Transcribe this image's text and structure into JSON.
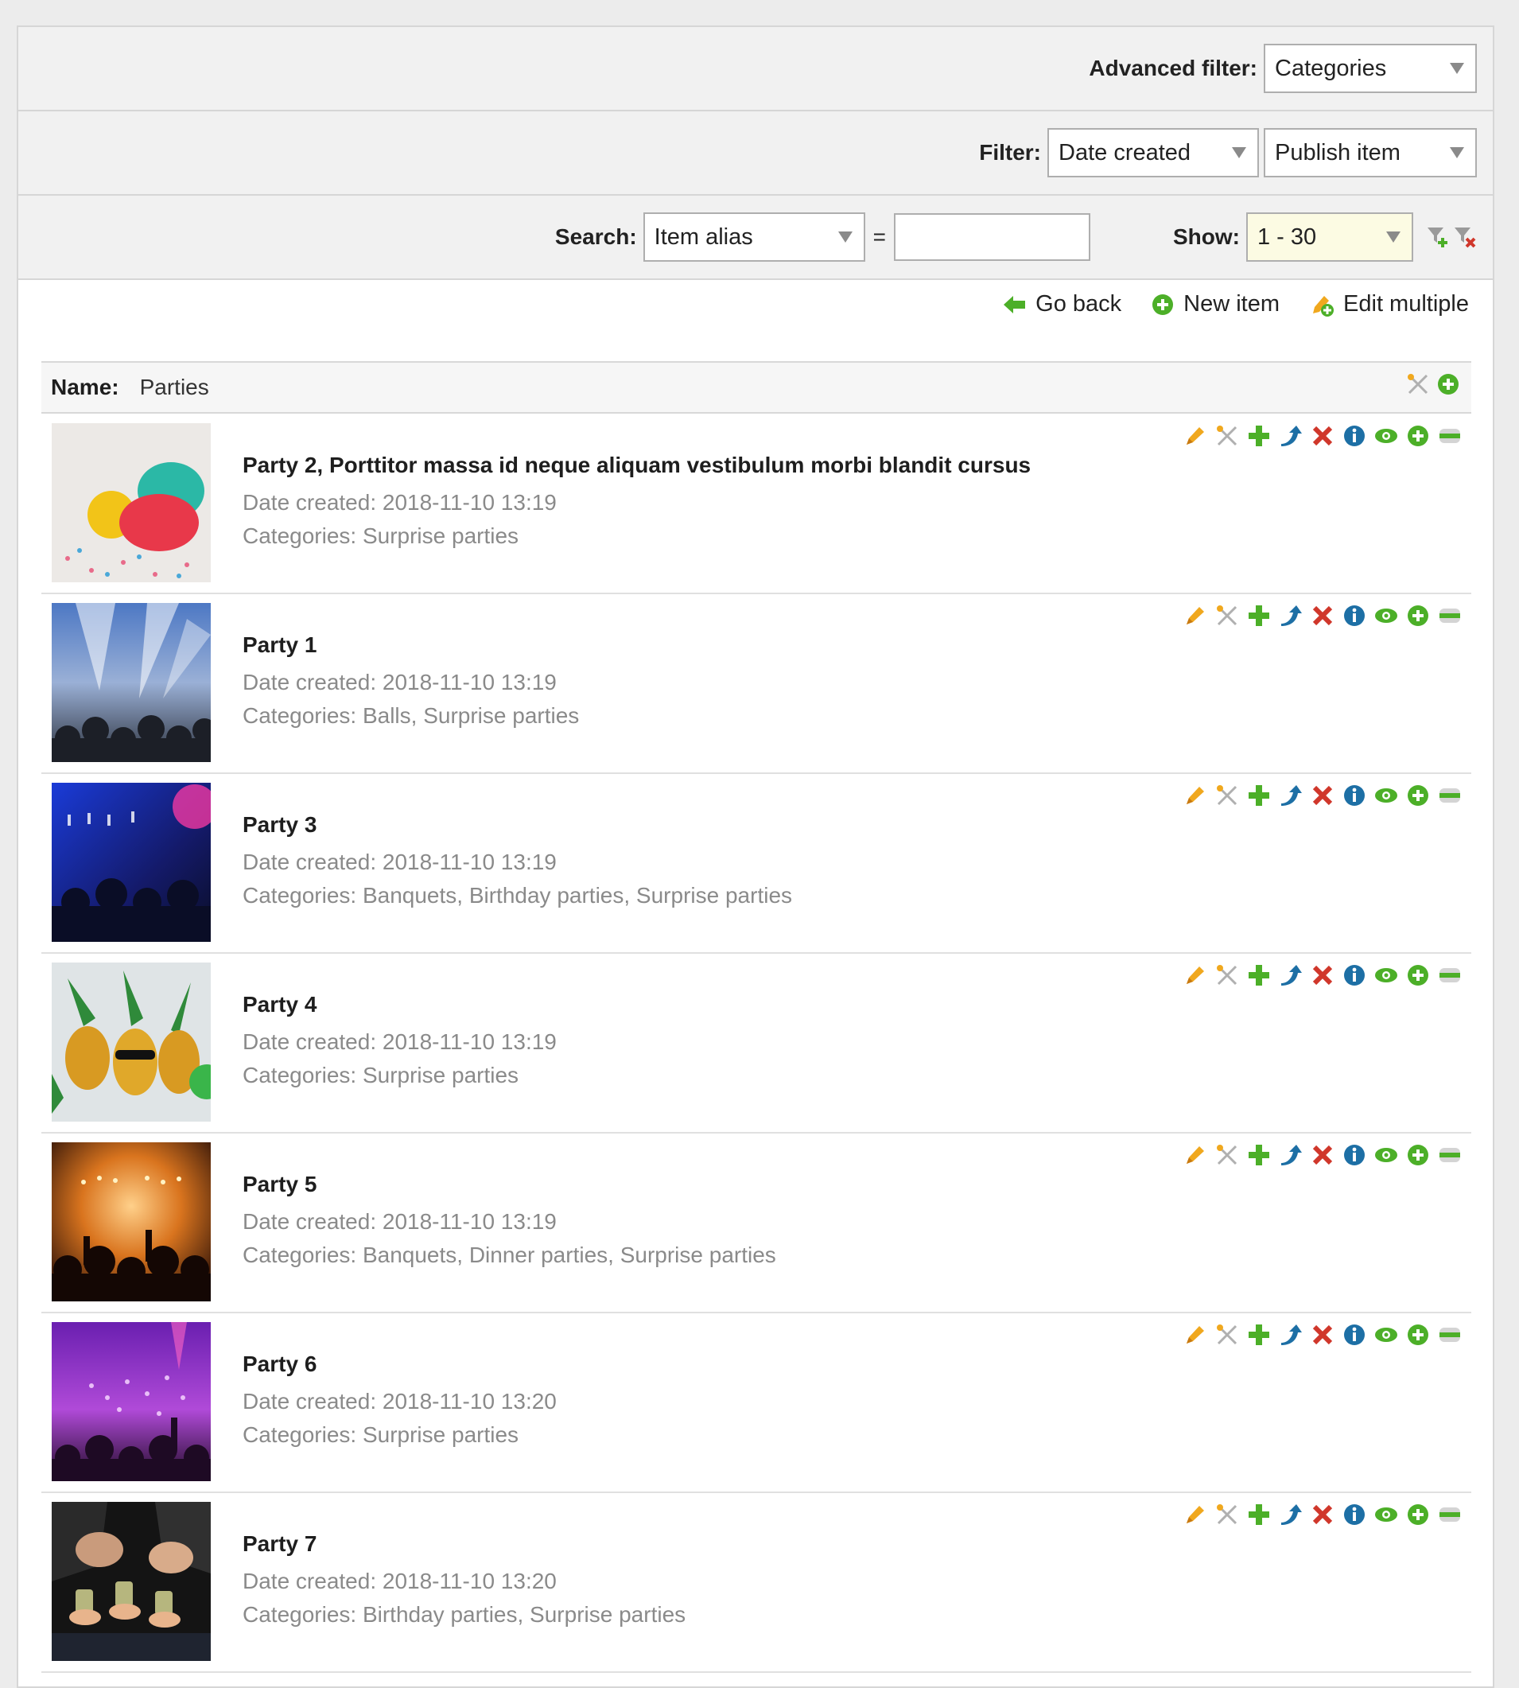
{
  "filters": {
    "advanced_label": "Advanced filter:",
    "advanced_value": "Categories",
    "filter_label": "Filter:",
    "filter_date_value": "Date created",
    "filter_publish_value": "Publish item",
    "search_label": "Search:",
    "search_field_value": "Item alias",
    "search_equals": "=",
    "search_input_value": "",
    "show_label": "Show:",
    "show_value": "1 - 30"
  },
  "actions": {
    "go_back": "Go back",
    "new_item": "New item",
    "edit_multiple": "Edit multiple"
  },
  "name_bar": {
    "label": "Name:",
    "value": "Parties"
  },
  "items": [
    {
      "title": "Party 2, Porttitor massa id neque aliquam vestibulum morbi blandit cursus",
      "date": "Date created: 2018-11-10 13:19",
      "categories": "Categories: Surprise parties"
    },
    {
      "title": "Party 1",
      "date": "Date created: 2018-11-10 13:19",
      "categories": "Categories: Balls, Surprise parties"
    },
    {
      "title": "Party 3",
      "date": "Date created: 2018-11-10 13:19",
      "categories": "Categories: Banquets, Birthday parties, Surprise parties"
    },
    {
      "title": "Party 4",
      "date": "Date created: 2018-11-10 13:19",
      "categories": "Categories: Surprise parties"
    },
    {
      "title": "Party 5",
      "date": "Date created: 2018-11-10 13:19",
      "categories": "Categories: Banquets, Dinner parties, Surprise parties"
    },
    {
      "title": "Party 6",
      "date": "Date created: 2018-11-10 13:20",
      "categories": "Categories: Surprise parties"
    },
    {
      "title": "Party 7",
      "date": "Date created: 2018-11-10 13:20",
      "categories": "Categories: Birthday parties, Surprise parties"
    }
  ],
  "row_tool_icons": [
    "pencil-icon",
    "tools-icon",
    "plus-icon",
    "move-arrow-icon",
    "delete-icon",
    "info-icon",
    "eye-icon",
    "add-circle-icon",
    "minus-bar-icon"
  ],
  "colors": {
    "orange": "#f0a81e",
    "green": "#4caf28",
    "blue": "#1d6fa5",
    "red": "#d0372b",
    "show_bg": "#fcfbe3"
  }
}
